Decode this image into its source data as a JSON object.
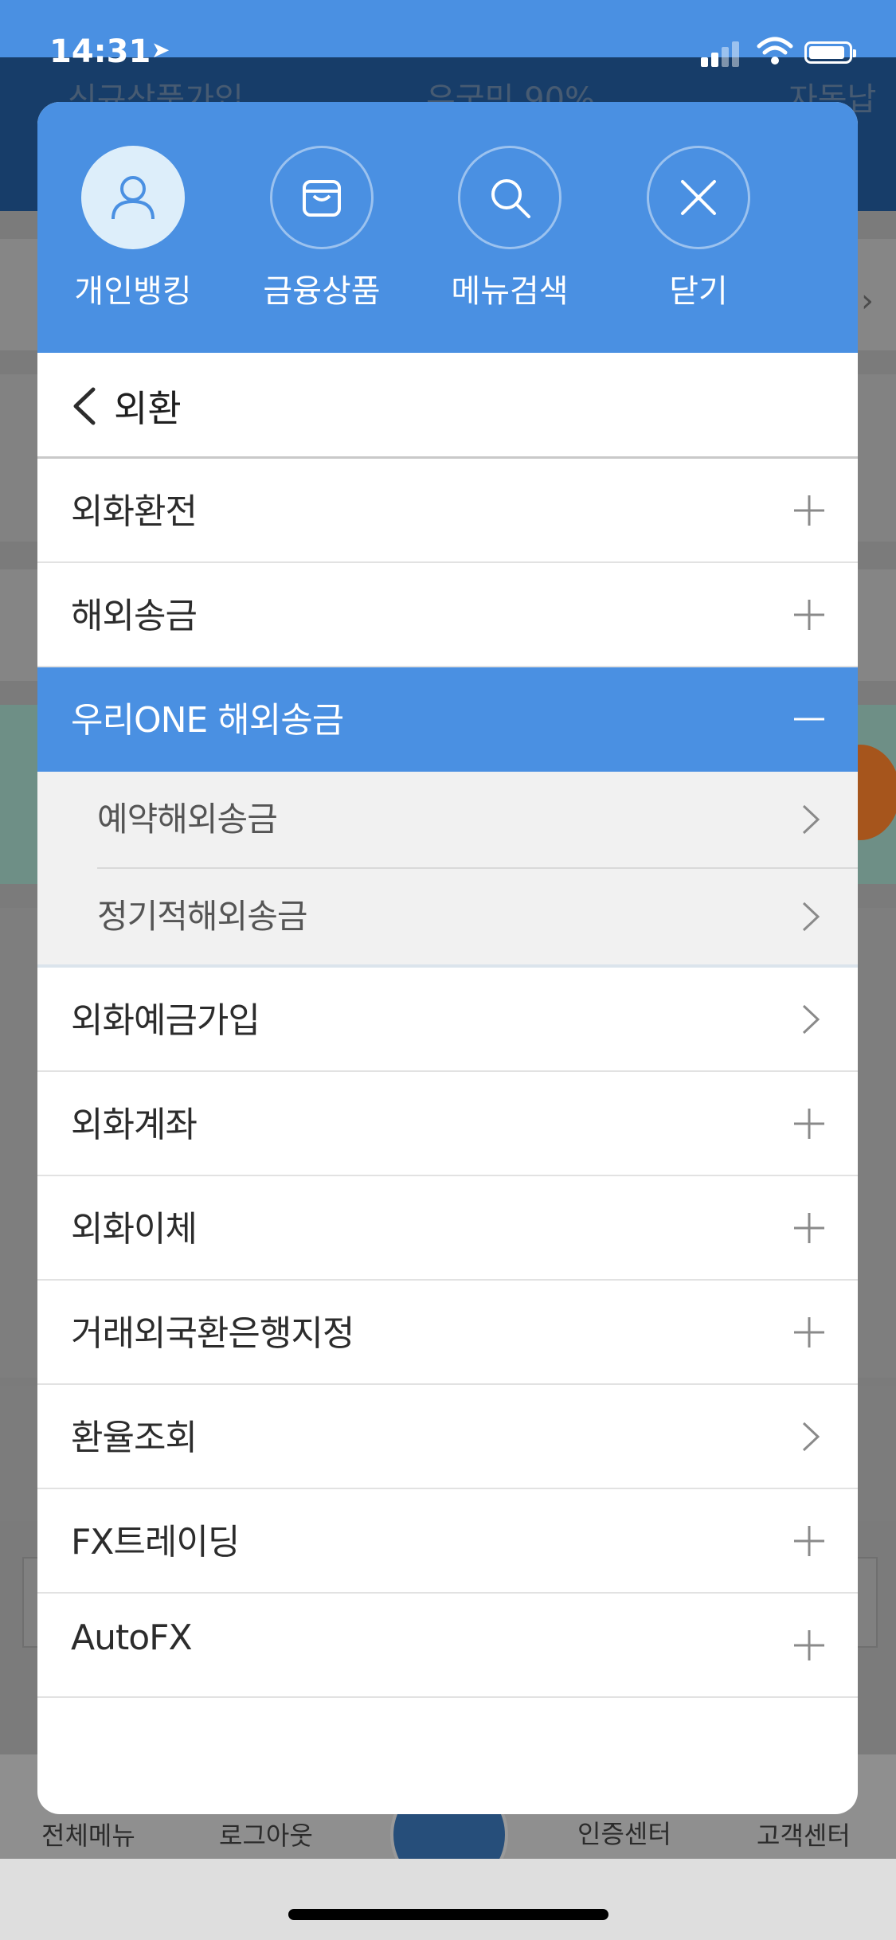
{
  "status_bar": {
    "time": "14:31"
  },
  "modal": {
    "top_menu": [
      {
        "label": "개인뱅킹",
        "icon": "person-icon",
        "active": true
      },
      {
        "label": "금융상품",
        "icon": "shopping-bag-icon",
        "active": false
      },
      {
        "label": "메뉴검색",
        "icon": "search-icon",
        "active": false
      },
      {
        "label": "닫기",
        "icon": "close-icon",
        "active": false
      }
    ],
    "nav": {
      "title": "외환"
    },
    "menu": {
      "items": [
        {
          "label": "외화환전",
          "icon": "plus-icon"
        },
        {
          "label": "해외송금",
          "icon": "plus-icon"
        },
        {
          "label": "우리ONE 해외송금",
          "icon": "minus-icon",
          "expanded": true
        },
        {
          "label": "외화예금가입",
          "icon": "chevron-right-icon"
        },
        {
          "label": "외화계좌",
          "icon": "plus-icon"
        },
        {
          "label": "외화이체",
          "icon": "plus-icon"
        },
        {
          "label": "거래외국환은행지정",
          "icon": "plus-icon"
        },
        {
          "label": "환율조회",
          "icon": "chevron-right-icon"
        },
        {
          "label": "FX트레이딩",
          "icon": "plus-icon"
        },
        {
          "label": "AutoFX",
          "icon": "plus-icon"
        }
      ],
      "subitems": [
        {
          "label": "예약해외송금",
          "icon": "chevron-right-icon"
        },
        {
          "label": "정기적해외송금",
          "icon": "chevron-right-icon"
        }
      ]
    }
  },
  "background": {
    "header_texts": [
      "신규상품가입",
      "우국민 90%",
      "자동납"
    ],
    "bottom_tabs": [
      "전체메뉴",
      "로그아웃",
      "인증센터",
      "고객센터"
    ]
  },
  "colors": {
    "accent": "#4a90e2",
    "text": "#2c2c2c",
    "sub_bg": "#f1f1f1"
  }
}
